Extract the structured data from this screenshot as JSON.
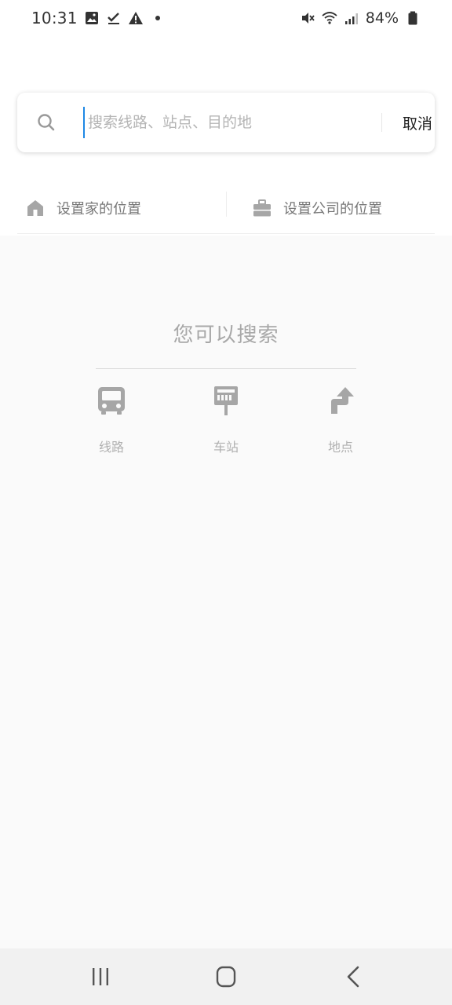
{
  "status_bar": {
    "time": "10:31",
    "left_icons": [
      "image-icon",
      "check-icon",
      "warning-icon",
      "dot-icon"
    ],
    "right_icons": [
      "mute-icon",
      "wifi-icon",
      "signal-icon"
    ],
    "battery_text": "84%"
  },
  "search": {
    "placeholder": "搜索线路、站点、目的地",
    "value": "",
    "cancel_label": "取消"
  },
  "quick_actions": {
    "home_label": "设置家的位置",
    "company_label": "设置公司的位置"
  },
  "hint": {
    "title": "您可以搜索",
    "categories": [
      {
        "icon": "bus-icon",
        "label": "线路"
      },
      {
        "icon": "bus-stop-icon",
        "label": "车站"
      },
      {
        "icon": "place-turn-icon",
        "label": "地点"
      }
    ]
  },
  "nav_bar": {
    "icons": [
      "recent-apps-icon",
      "home-icon",
      "back-icon"
    ]
  },
  "colors": {
    "accent": "#1e88e5",
    "icon_gray": "#a6a6a6",
    "background": "#fafafa"
  }
}
